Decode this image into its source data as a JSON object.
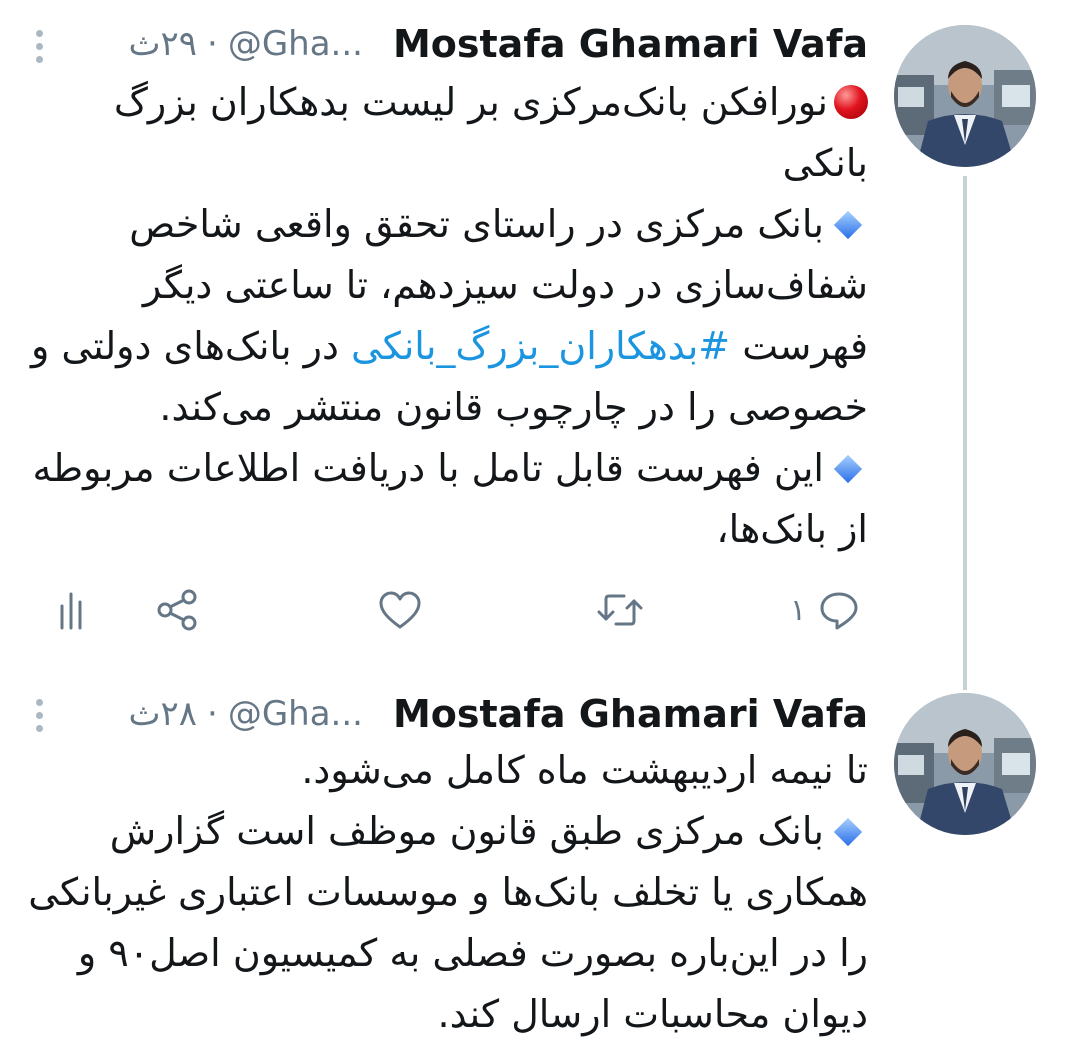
{
  "colors": {
    "text": "#14171a",
    "secondary": "#657786",
    "hashtag": "#1b95e0",
    "thread_line": "#c6d0d7"
  },
  "tweets": [
    {
      "author": "Mostafa Ghamari Vafa",
      "handle": "@Gha...",
      "separator": "·",
      "time": "۲۹ث",
      "lines": {
        "p1": "نورافکن بانک‌مرکزی بر لیست بدهکاران بزرگ بانکی",
        "p2_before": "بانک مرکزی در راستای تحقق واقعی شاخص شفاف‌سازی در دولت سیزدهم، تا ساعتی دیگر فهرست ",
        "p2_hashtag": "#بدهکاران_بزرگ_بانکی",
        "p2_after": " در بانک‌های دولتی و خصوصی را در چارچوب قانون منتشر می‌کند.",
        "p3": "این فهرست قابل تامل با دریافت اطلاعات مربوطه از بانک‌ها،"
      },
      "reply_count": "۱",
      "icons": {
        "reply": "reply-icon",
        "retweet": "retweet-icon",
        "like": "like-icon",
        "share": "share-icon",
        "analytics": "analytics-icon",
        "more": "more-vertical-icon"
      }
    },
    {
      "author": "Mostafa Ghamari Vafa",
      "handle": "@Gha...",
      "separator": "·",
      "time": "۲۸ث",
      "lines": {
        "p1": "تا نیمه اردیبهشت ماه کامل می‌شود.",
        "p2": "بانک مرکزی طبق قانون موظف است گزارش همکاری یا تخلف بانک‌ها و موسسات اعتباری غیربانکی را در این‌باره بصورت فصلی به کمیسیون اصل۹۰ و دیوان محاسبات ارسال کند."
      }
    }
  ]
}
